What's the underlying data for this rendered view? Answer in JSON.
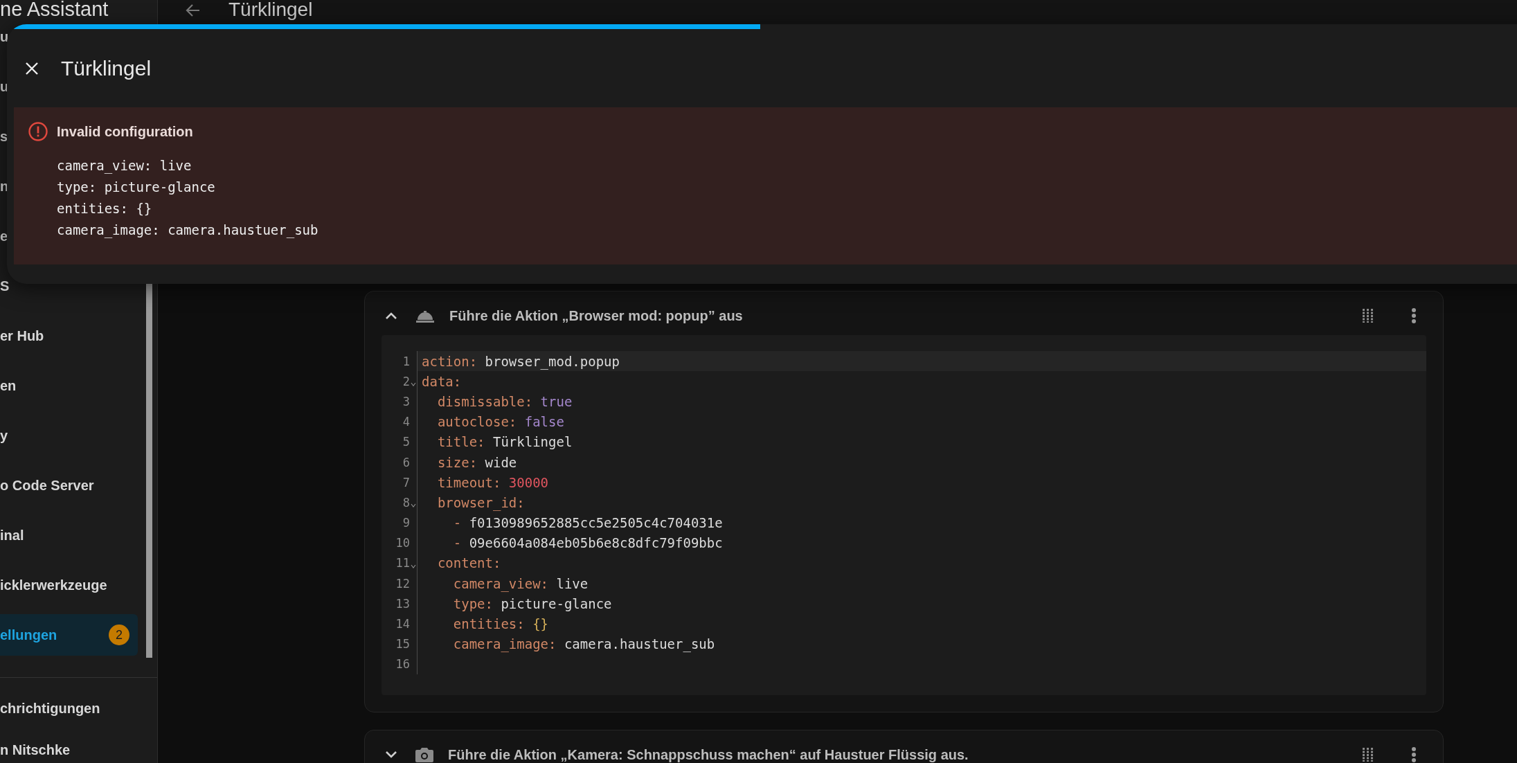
{
  "sidebar": {
    "title": "ne Assistant",
    "items": [
      {
        "label": "u",
        "selected": false
      },
      {
        "label": "u",
        "selected": false
      },
      {
        "label": "s",
        "selected": false
      },
      {
        "label": "n",
        "selected": false
      },
      {
        "label": "e",
        "selected": false
      },
      {
        "label": "S",
        "selected": false
      },
      {
        "label": "er Hub",
        "selected": false
      },
      {
        "label": "en",
        "selected": false
      },
      {
        "label": "y",
        "selected": false
      },
      {
        "label": "o Code Server",
        "selected": false
      },
      {
        "label": "inal",
        "selected": false
      },
      {
        "label": "icklerwerkzeuge",
        "selected": false
      },
      {
        "label": "ellungen",
        "selected": true,
        "badge": "2"
      }
    ],
    "bottom_items": [
      {
        "label": "chrichtigungen"
      },
      {
        "label": "n Nitschke"
      }
    ]
  },
  "toolbar": {
    "title": "Türklingel"
  },
  "actions": [
    {
      "expanded": true,
      "title": "Führe die Aktion „Browser mod: popup” aus",
      "code_lines": [
        {
          "n": "1",
          "active": true,
          "tokens": [
            {
              "kind": "key",
              "text": "action:"
            },
            {
              "kind": "string",
              "text": " browser_mod.popup"
            }
          ]
        },
        {
          "n": "2",
          "fold": true,
          "tokens": [
            {
              "kind": "key",
              "text": "data:"
            }
          ]
        },
        {
          "n": "3",
          "tokens": [
            {
              "kind": "key",
              "text": "  dismissable:"
            },
            {
              "kind": "bool",
              "text": " true"
            }
          ]
        },
        {
          "n": "4",
          "tokens": [
            {
              "kind": "key",
              "text": "  autoclose:"
            },
            {
              "kind": "bool",
              "text": " false"
            }
          ]
        },
        {
          "n": "5",
          "tokens": [
            {
              "kind": "key",
              "text": "  title:"
            },
            {
              "kind": "string",
              "text": " Türklingel"
            }
          ]
        },
        {
          "n": "6",
          "tokens": [
            {
              "kind": "key",
              "text": "  size:"
            },
            {
              "kind": "string",
              "text": " wide"
            }
          ]
        },
        {
          "n": "7",
          "tokens": [
            {
              "kind": "key",
              "text": "  timeout:"
            },
            {
              "kind": "number",
              "text": " 30000"
            }
          ]
        },
        {
          "n": "8",
          "fold": true,
          "tokens": [
            {
              "kind": "key",
              "text": "  browser_id:"
            }
          ]
        },
        {
          "n": "9",
          "tokens": [
            {
              "kind": "key",
              "text": "    -"
            },
            {
              "kind": "string",
              "text": " f0130989652885cc5e2505c4c704031e"
            }
          ]
        },
        {
          "n": "10",
          "tokens": [
            {
              "kind": "key",
              "text": "    -"
            },
            {
              "kind": "string",
              "text": " 09e6604a084eb05b6e8c8dfc79f09bbc"
            }
          ]
        },
        {
          "n": "11",
          "fold": true,
          "tokens": [
            {
              "kind": "key",
              "text": "  content:"
            }
          ]
        },
        {
          "n": "12",
          "tokens": [
            {
              "kind": "key",
              "text": "    camera_view:"
            },
            {
              "kind": "string",
              "text": " live"
            }
          ]
        },
        {
          "n": "13",
          "tokens": [
            {
              "kind": "key",
              "text": "    type:"
            },
            {
              "kind": "string",
              "text": " picture-glance"
            }
          ]
        },
        {
          "n": "14",
          "tokens": [
            {
              "kind": "key",
              "text": "    entities:"
            },
            {
              "kind": "brace",
              "text": " {}"
            }
          ]
        },
        {
          "n": "15",
          "tokens": [
            {
              "kind": "key",
              "text": "    camera_image:"
            },
            {
              "kind": "string",
              "text": " camera.haustuer_sub"
            }
          ]
        },
        {
          "n": "16"
        }
      ]
    },
    {
      "expanded": false,
      "title": "Führe die Aktion „Kamera: Schnappschuss machen“ auf Haustuer Flüssig aus."
    }
  ],
  "dialog": {
    "title": "Türklingel",
    "progress": {
      "level": 0.49
    },
    "error": {
      "title": "Invalid configuration",
      "lines": [
        "camera_view: live",
        "type: picture-glance",
        "entities: {}",
        "camera_image: camera.haustuer_sub"
      ]
    }
  }
}
